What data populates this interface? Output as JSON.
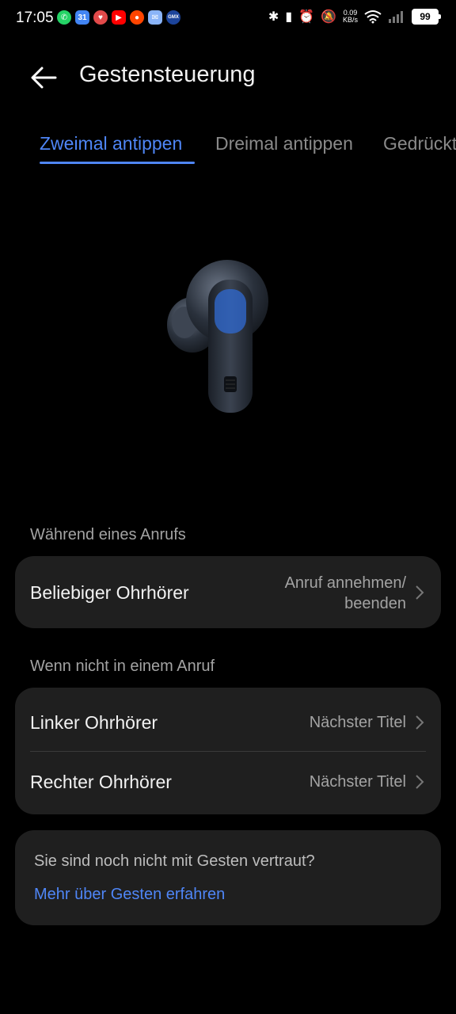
{
  "status_bar": {
    "time": "17:05",
    "net_speed_value": "0.09",
    "net_speed_unit": "KB/s",
    "battery": "99",
    "notification_icons": [
      "whatsapp-icon",
      "calendar-icon",
      "app-icon",
      "youtube-icon",
      "reddit-icon",
      "mail-icon",
      "gmx-icon"
    ],
    "calendar_day": "31",
    "gmx_label": "GMX"
  },
  "header": {
    "title": "Gestensteuerung"
  },
  "tabs": [
    {
      "label": "Zweimal antippen",
      "active": true
    },
    {
      "label": "Dreimal antippen",
      "active": false
    },
    {
      "label": "Gedrückt halten",
      "active": false
    }
  ],
  "during_call": {
    "section_label": "Während eines Anrufs",
    "row_label": "Beliebiger Ohrhörer",
    "row_value_line1": "Anruf annehmen/",
    "row_value_line2": "beenden"
  },
  "not_in_call": {
    "section_label": "Wenn nicht in einem Anruf",
    "rows": [
      {
        "label": "Linker Ohrhörer",
        "value": "Nächster Titel"
      },
      {
        "label": "Rechter Ohrhörer",
        "value": "Nächster Titel"
      }
    ]
  },
  "hint": {
    "text": "Sie sind noch nicht mit Gesten vertraut?",
    "link": "Mehr über Gesten erfahren"
  },
  "colors": {
    "accent": "#4f86f7",
    "background": "#000000",
    "card": "#1f1f1f"
  }
}
